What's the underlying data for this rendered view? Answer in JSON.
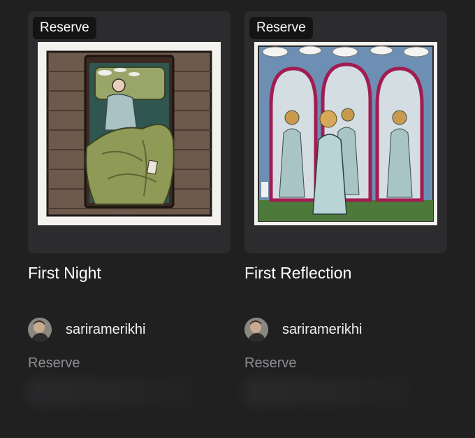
{
  "cards": [
    {
      "badge": "Reserve",
      "title": "First Night",
      "artist": "sariramerikhi",
      "status": "Reserve",
      "image_icon": "artwork-sleeping-figure-in-bed"
    },
    {
      "badge": "Reserve",
      "title": "First Reflection",
      "artist": "sariramerikhi",
      "status": "Reserve",
      "image_icon": "artwork-figure-facing-mirrors"
    }
  ],
  "colors": {
    "background": "#202021",
    "card_surface": "#2c2c2e",
    "badge_bg": "#141414",
    "muted_text": "#8e8e93"
  }
}
